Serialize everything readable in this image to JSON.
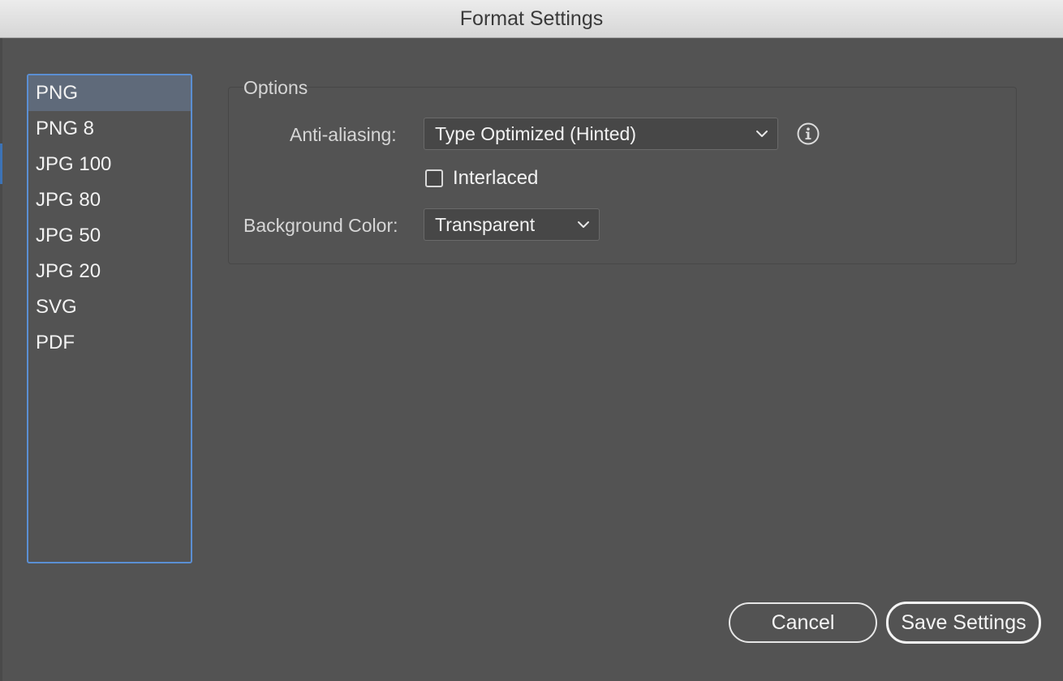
{
  "window": {
    "title": "Format Settings"
  },
  "formats": {
    "items": [
      {
        "label": "PNG",
        "selected": true
      },
      {
        "label": "PNG 8",
        "selected": false
      },
      {
        "label": "JPG 100",
        "selected": false
      },
      {
        "label": "JPG 80",
        "selected": false
      },
      {
        "label": "JPG 50",
        "selected": false
      },
      {
        "label": "JPG 20",
        "selected": false
      },
      {
        "label": "SVG",
        "selected": false
      },
      {
        "label": "PDF",
        "selected": false
      }
    ]
  },
  "options": {
    "legend": "Options",
    "anti_aliasing": {
      "label": "Anti-aliasing:",
      "value": "Type Optimized (Hinted)"
    },
    "interlaced": {
      "label": "Interlaced",
      "checked": false
    },
    "background_color": {
      "label": "Background Color:",
      "value": "Transparent"
    }
  },
  "buttons": {
    "cancel": "Cancel",
    "save": "Save Settings"
  },
  "icons": {
    "info": "info-icon",
    "chevron": "chevron-down-icon"
  },
  "colors": {
    "dialog_bg": "#535353",
    "list_border": "#5b8fd3",
    "selected_row": "#5f6a7a"
  }
}
